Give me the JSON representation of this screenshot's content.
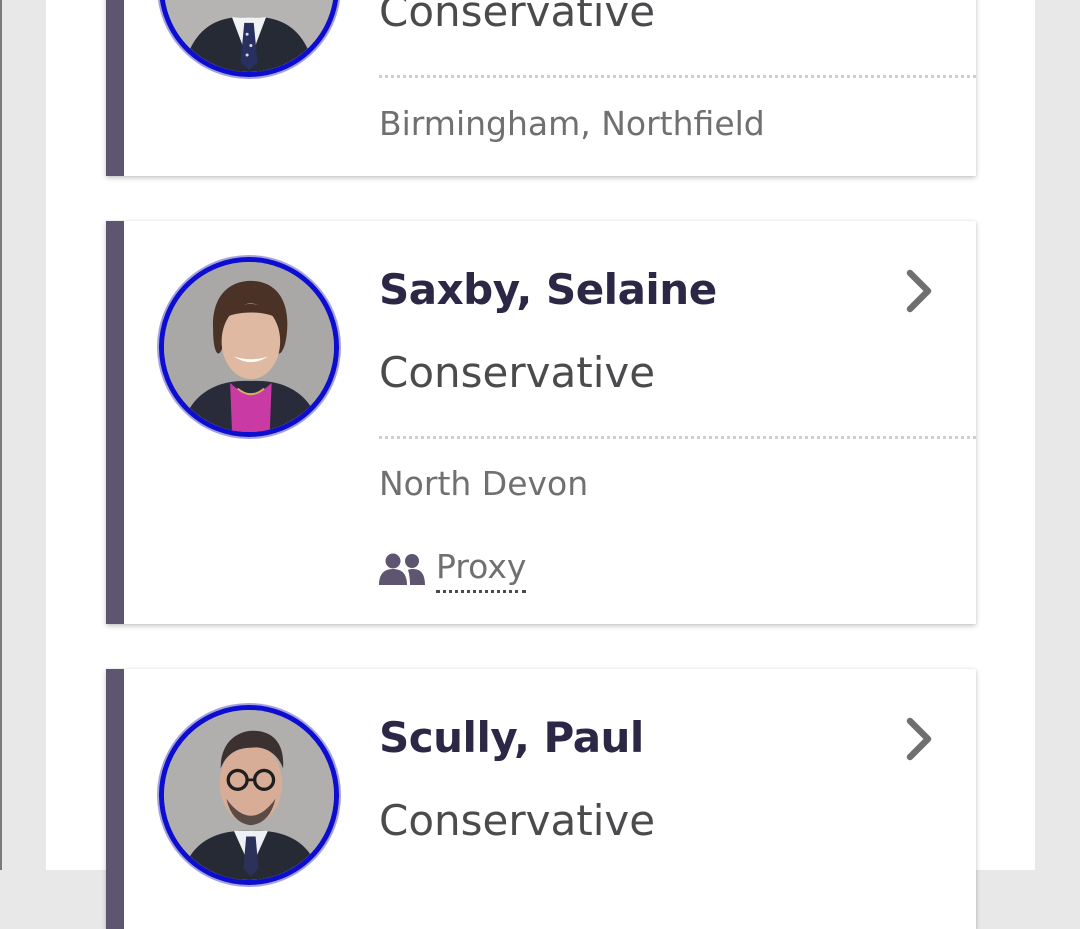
{
  "colors": {
    "page_background": "#e9e8e8",
    "card_background": "#ffffff",
    "card_accent": "#5e5670",
    "avatar_ring": "#0d0dcf",
    "name_text": "#2c2745",
    "chevron": "#6f6f6f"
  },
  "members": [
    {
      "name": "",
      "party": "Conservative",
      "constituency": "Birmingham, Northfield",
      "chevron_icon": "chevron-right-icon",
      "avatar_alt": "member-portrait"
    },
    {
      "name": "Saxby, Selaine",
      "party": "Conservative",
      "constituency": "North Devon",
      "proxy_label": "Proxy",
      "proxy_icon": "people-icon",
      "chevron_icon": "chevron-right-icon",
      "avatar_alt": "member-portrait"
    },
    {
      "name": "Scully, Paul",
      "party": "Conservative",
      "chevron_icon": "chevron-right-icon",
      "avatar_alt": "member-portrait"
    }
  ]
}
